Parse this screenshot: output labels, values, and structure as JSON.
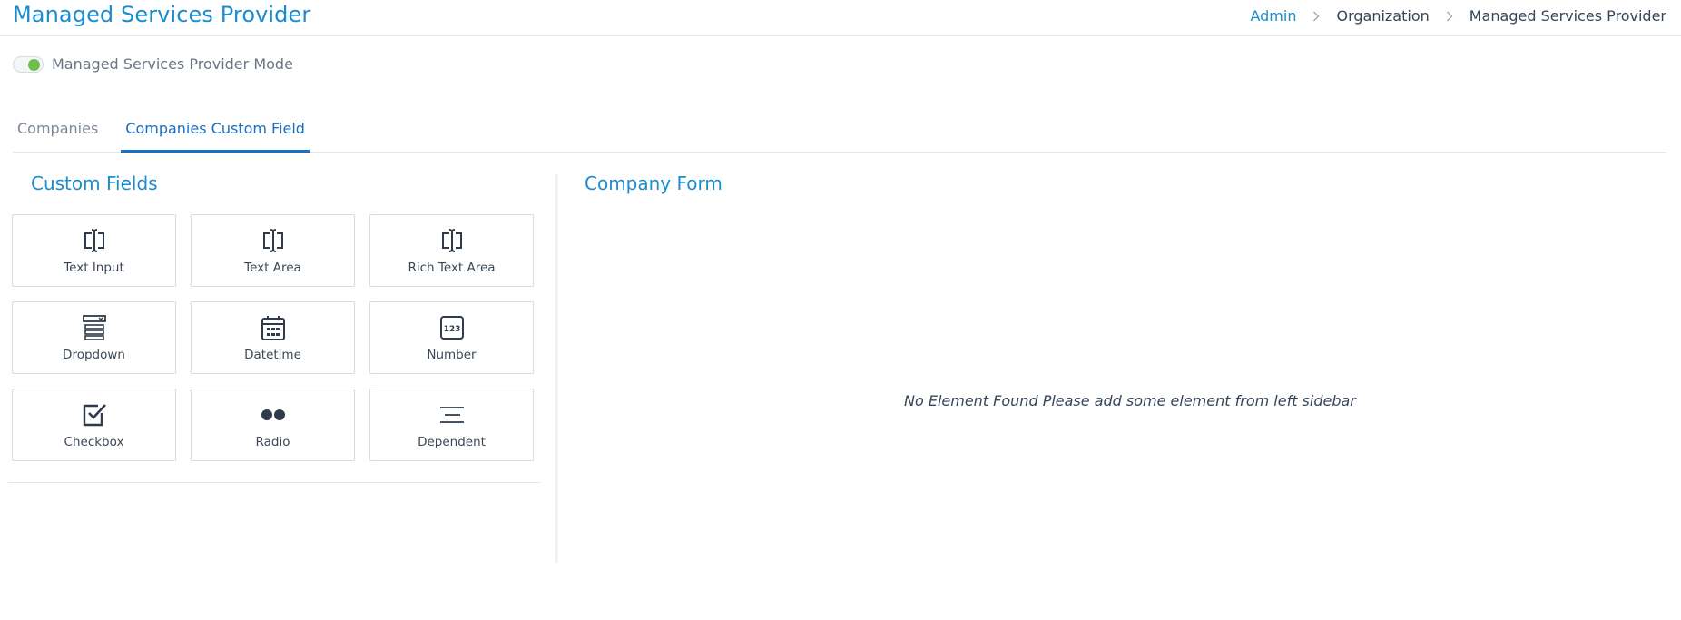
{
  "header": {
    "title": "Managed Services Provider",
    "breadcrumb": [
      "Admin",
      "Organization",
      "Managed Services Provider"
    ]
  },
  "mode_toggle": {
    "label": "Managed Services Provider Mode",
    "enabled": true,
    "on_color": "#6cc04a"
  },
  "tabs": [
    {
      "label": "Companies",
      "active": false
    },
    {
      "label": "Companies Custom Field",
      "active": true
    }
  ],
  "custom_fields": {
    "title": "Custom Fields",
    "items": [
      {
        "label": "Text Input",
        "icon": "text-cursor-icon"
      },
      {
        "label": "Text Area",
        "icon": "text-cursor-icon"
      },
      {
        "label": "Rich Text Area",
        "icon": "text-cursor-icon"
      },
      {
        "label": "Dropdown",
        "icon": "dropdown-icon"
      },
      {
        "label": "Datetime",
        "icon": "calendar-icon"
      },
      {
        "label": "Number",
        "icon": "number-icon"
      },
      {
        "label": "Checkbox",
        "icon": "checkbox-icon"
      },
      {
        "label": "Radio",
        "icon": "radio-icon"
      },
      {
        "label": "Dependent",
        "icon": "dependent-lines-icon"
      }
    ]
  },
  "company_form": {
    "title": "Company Form",
    "empty_message": "No Element Found Please add some element from left sidebar"
  },
  "colors": {
    "accent": "#1b8ccd",
    "active_tab": "#1b6fc0"
  }
}
